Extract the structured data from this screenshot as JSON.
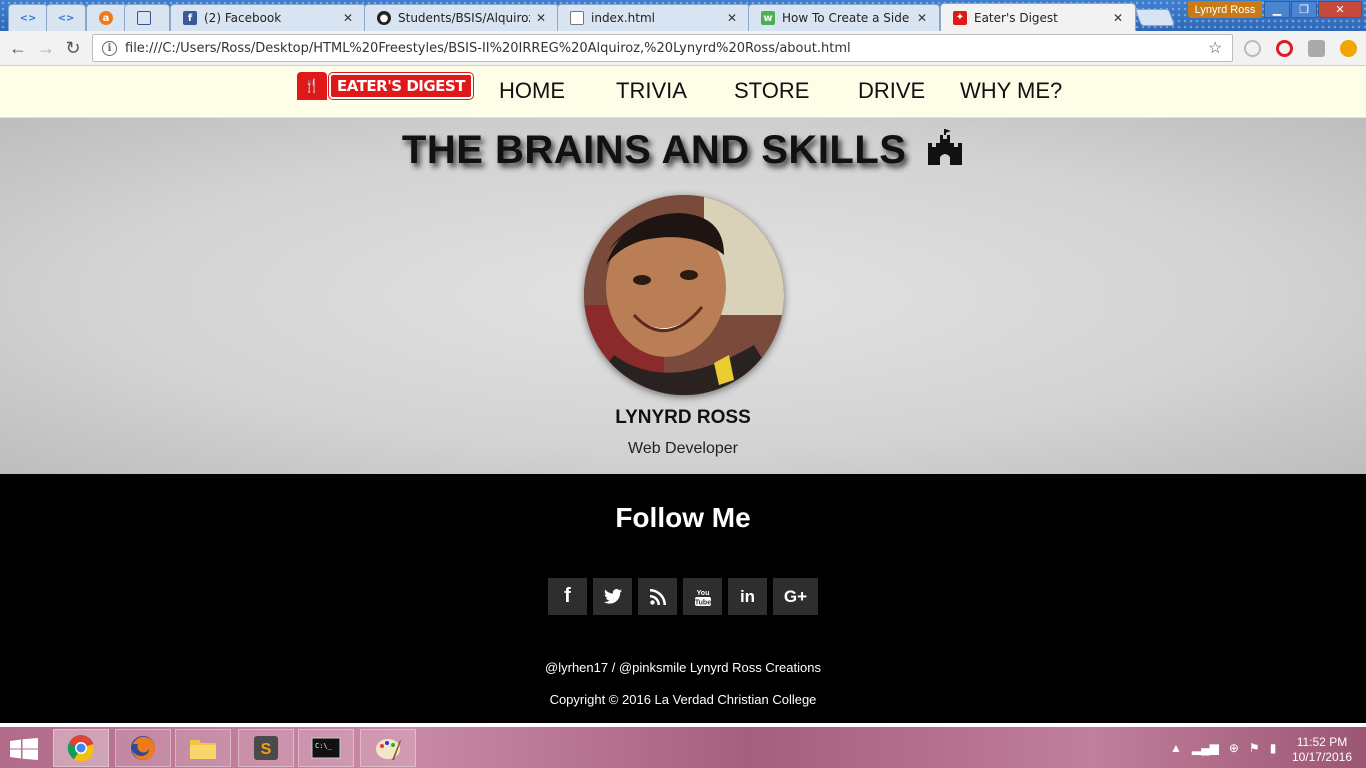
{
  "browser": {
    "tabs": [
      {
        "label": "",
        "favicon": "code-icon"
      },
      {
        "label": "",
        "favicon": "code-icon"
      },
      {
        "label": "",
        "favicon": "avast-icon"
      },
      {
        "label": "",
        "favicon": "grid-icon"
      },
      {
        "label": "(2) Facebook",
        "favicon": "facebook-icon"
      },
      {
        "label": "Students/BSIS/Alquiroz-L",
        "favicon": "github-icon"
      },
      {
        "label": "index.html",
        "favicon": "file-icon"
      },
      {
        "label": "How To Create a Side Na",
        "favicon": "w3schools-icon"
      },
      {
        "label": "Eater's Digest",
        "favicon": "eaters-digest-icon"
      }
    ],
    "profile_name": "Lynyrd Ross",
    "url": "file:///C:/Users/Ross/Desktop/HTML%20Freestyles/BSIS-II%20IRREG%20Alquiroz,%20Lynyrd%20Ross/about.html"
  },
  "site": {
    "logo_text": "EATER'S DIGEST",
    "nav": [
      "HOME",
      "TRIVIA",
      "STORE",
      "DRIVE",
      "WHY ME?"
    ]
  },
  "hero": {
    "title": "THE BRAINS AND SKILLS",
    "title_icon": "castle-icon",
    "name": "LYNYRD ROSS",
    "role": "Web Developer"
  },
  "footer": {
    "follow_title": "Follow Me",
    "socials": [
      {
        "name": "facebook-icon",
        "glyph": "f"
      },
      {
        "name": "twitter-icon",
        "glyph": "🐦"
      },
      {
        "name": "rss-icon",
        "glyph": "◔"
      },
      {
        "name": "youtube-icon",
        "glyph": "You"
      },
      {
        "name": "linkedin-icon",
        "glyph": "in"
      },
      {
        "name": "google-plus-icon",
        "glyph": "G+"
      }
    ],
    "credits": "@lyrhen17 / @pinksmile Lynyrd Ross Creations",
    "copyright": "Copyright © 2016 La Verdad Christian College"
  },
  "taskbar": {
    "time": "11:52 PM",
    "date": "10/17/2016"
  },
  "colors": {
    "brand_red": "#e01818",
    "nav_bg": "#fdfde8",
    "footer_bg": "#000000"
  }
}
